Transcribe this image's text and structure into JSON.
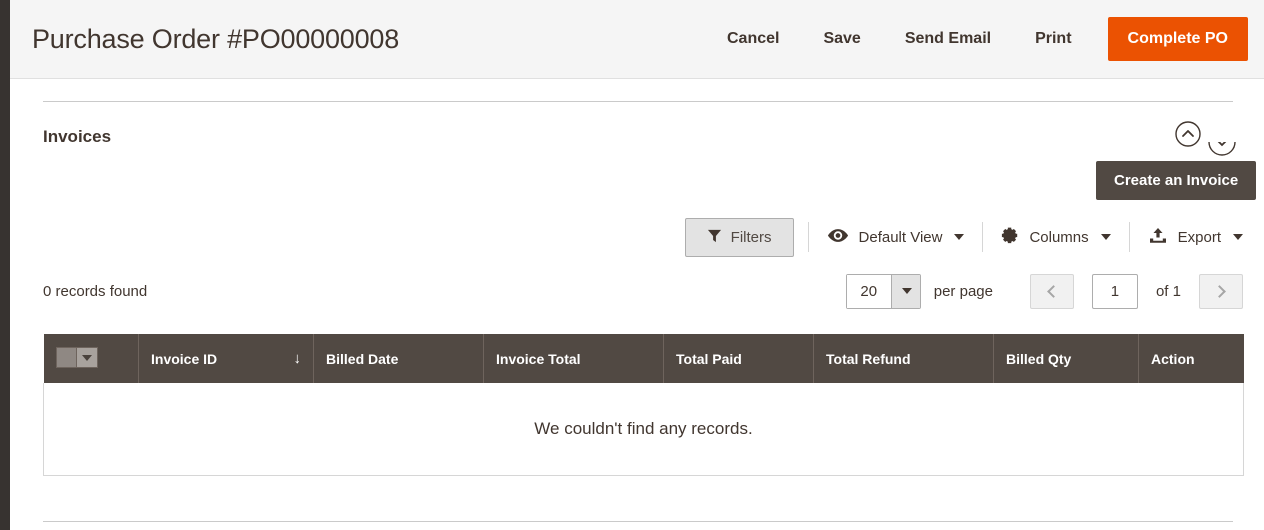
{
  "header": {
    "title": "Purchase Order #PO00000008",
    "actions": [
      {
        "label": "Cancel",
        "name": "cancel-button"
      },
      {
        "label": "Save",
        "name": "save-button"
      },
      {
        "label": "Send Email",
        "name": "send-email-button"
      },
      {
        "label": "Print",
        "name": "print-button"
      }
    ],
    "primary_action": "Complete PO",
    "primary_color": "#eb5202"
  },
  "section": {
    "title": "Invoices",
    "collapse_icon": "chevron-up-circle-icon",
    "create_button": "Create an Invoice"
  },
  "toolbar": {
    "filters_label": "Filters",
    "filters_icon": "funnel-icon",
    "view_label": "Default View",
    "view_icon": "eye-icon",
    "columns_label": "Columns",
    "columns_icon": "gear-icon",
    "export_label": "Export",
    "export_icon": "export-upload-icon"
  },
  "pager": {
    "records_found": "0 records found",
    "per_page_value": "20",
    "per_page_label": "per page",
    "page_value": "1",
    "of_label": "of 1",
    "prev_icon": "chevron-left-icon",
    "next_icon": "chevron-right-icon"
  },
  "grid": {
    "columns": [
      {
        "label": "",
        "name": "select-all-column"
      },
      {
        "label": "Invoice ID",
        "name": "invoice-id-column",
        "sort": "↓"
      },
      {
        "label": "Billed Date",
        "name": "billed-date-column"
      },
      {
        "label": "Invoice Total",
        "name": "invoice-total-column"
      },
      {
        "label": "Total Paid",
        "name": "total-paid-column"
      },
      {
        "label": "Total Refund",
        "name": "total-refund-column"
      },
      {
        "label": "Billed Qty",
        "name": "billed-qty-column"
      },
      {
        "label": "Action",
        "name": "action-column"
      }
    ],
    "rows": [],
    "empty_message": "We couldn't find any records.",
    "header_bg": "#514943"
  }
}
